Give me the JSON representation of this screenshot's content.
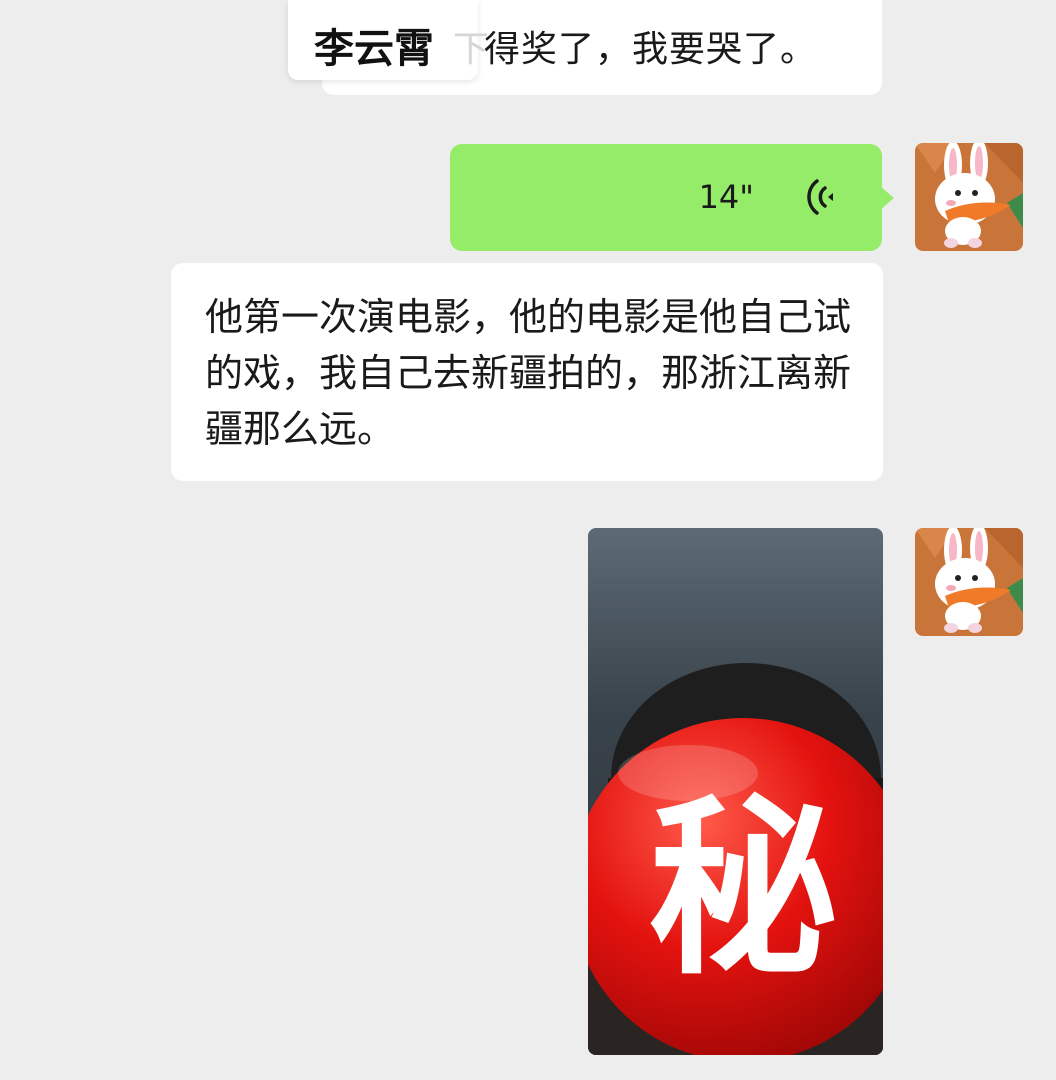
{
  "messages": [
    {
      "kind": "text",
      "side": "left",
      "partial": true,
      "sender_name": "李云霄",
      "text": "得奖了，我要哭了。"
    },
    {
      "kind": "voice",
      "side": "right",
      "duration": "14\""
    },
    {
      "kind": "text",
      "side": "left",
      "text": "他第一次演电影，他的电影是他自己试的戏，我自己去新疆拍的，那浙江离新疆那么远。"
    },
    {
      "kind": "image",
      "side": "right",
      "overlay_character": "秘"
    }
  ],
  "colors": {
    "background": "#ededed",
    "sent_bubble": "#95ec69",
    "received_bubble": "#ffffff",
    "censor_badge": "#e3120f"
  },
  "icons": [
    "voice-wave-icon",
    "avatar-bunny-icon"
  ]
}
